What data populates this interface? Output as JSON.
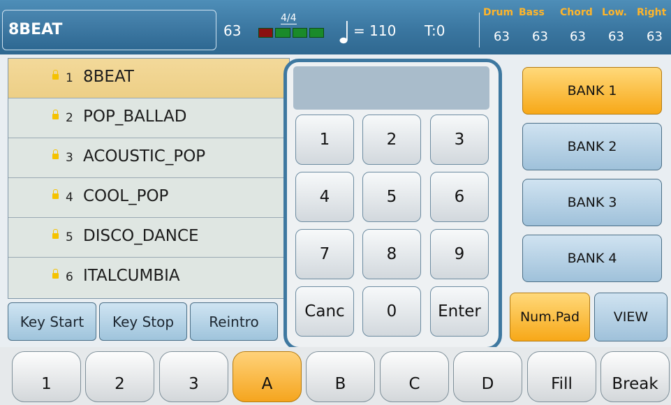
{
  "header": {
    "style_name": "8BEAT",
    "master_volume": "63",
    "time_signature": "4/4",
    "tempo": "= 110",
    "transpose": "T:0",
    "channels": [
      {
        "label": "Drum",
        "value": "63"
      },
      {
        "label": "Bass",
        "value": "63"
      },
      {
        "label": "Chord",
        "value": "63"
      },
      {
        "label": "Low.",
        "value": "63"
      },
      {
        "label": "Right",
        "value": "63"
      }
    ]
  },
  "styles": [
    {
      "num": "1",
      "name": "8BEAT",
      "selected": true
    },
    {
      "num": "2",
      "name": "POP_BALLAD",
      "selected": false
    },
    {
      "num": "3",
      "name": "ACOUSTIC_POP",
      "selected": false
    },
    {
      "num": "4",
      "name": "COOL_POP",
      "selected": false
    },
    {
      "num": "5",
      "name": "DISCO_DANCE",
      "selected": false
    },
    {
      "num": "6",
      "name": "ITALCUMBIA",
      "selected": false
    }
  ],
  "list_buttons": [
    "Key Start",
    "Key Stop",
    "Reintro"
  ],
  "numpad": {
    "display": "",
    "keys": [
      "1",
      "2",
      "3",
      "4",
      "5",
      "6",
      "7",
      "8",
      "9",
      "Canc",
      "0",
      "Enter"
    ]
  },
  "banks": [
    "BANK 1",
    "BANK 2",
    "BANK 3",
    "BANK 4"
  ],
  "side_buttons": {
    "numpad": "Num.Pad",
    "view": "VIEW"
  },
  "sections": [
    "1",
    "2",
    "3",
    "A",
    "B",
    "C",
    "D",
    "Fill",
    "Break"
  ],
  "colors": {
    "accent": "#f7a818",
    "header": "#3a76a0",
    "selected_row": "#f0d48f",
    "meter_green": "#1a8a2a",
    "meter_red": "#8a1010",
    "channel_label": "#ffb52a"
  },
  "icons": {
    "lock": "lock-icon",
    "note": "quarter-note-icon"
  }
}
